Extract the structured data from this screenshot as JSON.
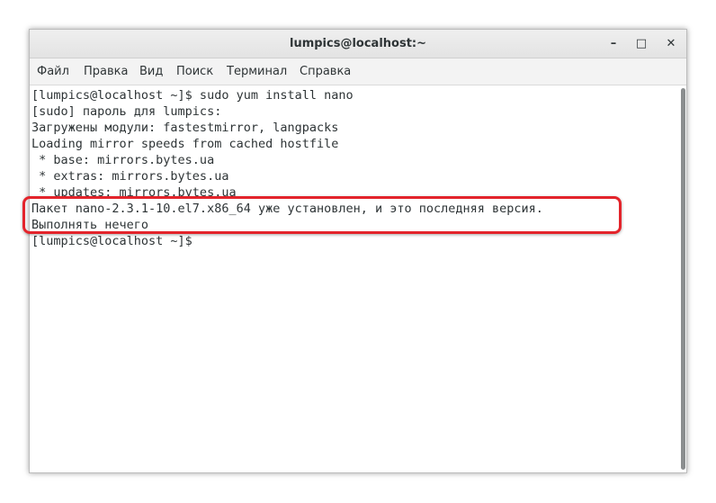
{
  "window": {
    "title": "lumpics@localhost:~",
    "minimize_glyph": "–",
    "maximize_glyph": "□",
    "close_glyph": "✕"
  },
  "menu": {
    "items": [
      "Файл",
      "Правка",
      "Вид",
      "Поиск",
      "Терминал",
      "Справка"
    ]
  },
  "terminal": {
    "lines": [
      "[lumpics@localhost ~]$ sudo yum install nano",
      "[sudo] пароль для lumpics:",
      "Загружены модули: fastestmirror, langpacks",
      "Loading mirror speeds from cached hostfile",
      " * base: mirrors.bytes.ua",
      " * extras: mirrors.bytes.ua",
      " * updates: mirrors.bytes.ua",
      "Пакет nano-2.3.1-10.el7.x86_64 уже установлен, и это последняя версия.",
      "Выполнять нечего",
      "[lumpics@localhost ~]$"
    ]
  },
  "colors": {
    "highlight": "#e3242b",
    "text": "#2e3436"
  }
}
